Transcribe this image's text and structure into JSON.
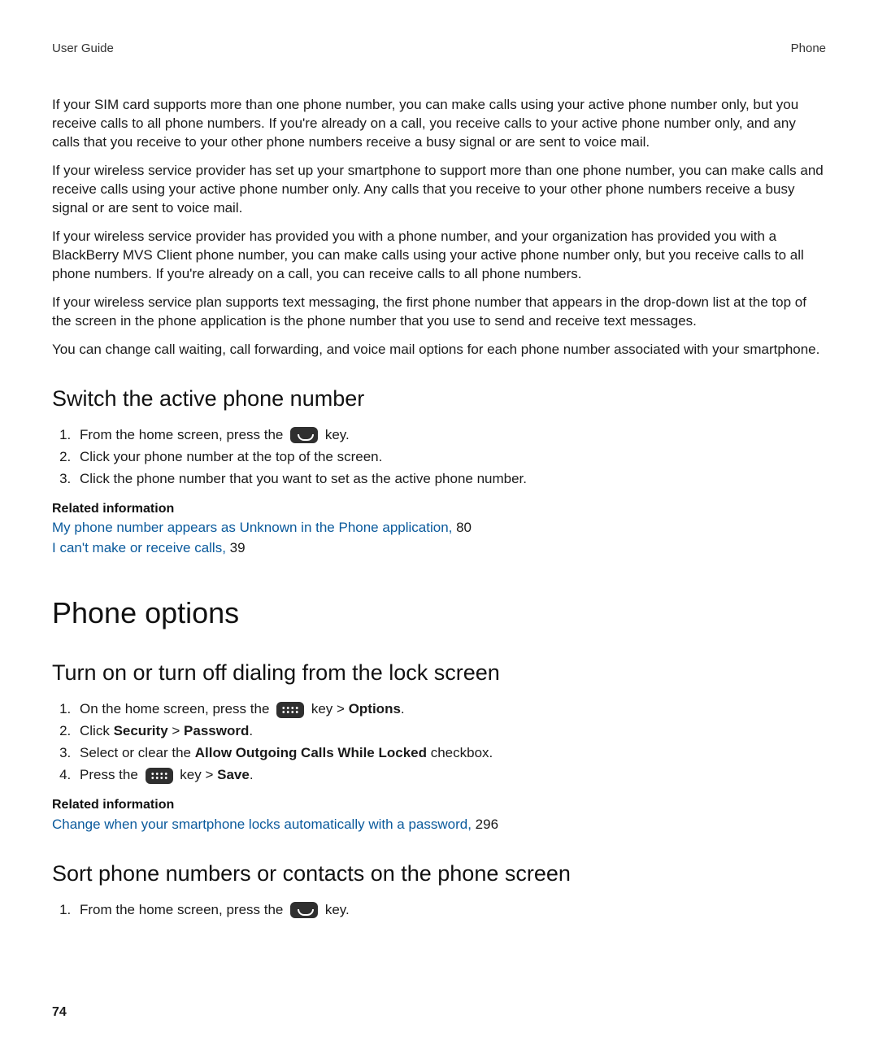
{
  "header": {
    "left": "User Guide",
    "right": "Phone"
  },
  "intro": {
    "p1": "If your SIM card supports more than one phone number, you can make calls using your active phone number only, but you receive calls to all phone numbers. If you're already on a call, you receive calls to your active phone number only, and any calls that you receive to your other phone numbers receive a busy signal or are sent to voice mail.",
    "p2": "If your wireless service provider has set up your smartphone to support more than one phone number, you can make calls and receive calls using your active phone number only. Any calls that you receive to your other phone numbers receive a busy signal or are sent to voice mail.",
    "p3": "If your wireless service provider has provided you with a phone number, and your organization has provided you with a BlackBerry MVS Client phone number, you can make calls using your active phone number only, but you receive calls to all phone numbers. If you're already on a call, you can receive calls to all phone numbers.",
    "p4": "If your wireless service plan supports text messaging, the first phone number that appears in the drop-down list at the top of the screen in the phone application is the phone number that you use to send and receive text messages.",
    "p5": "You can change call waiting, call forwarding, and voice mail options for each phone number associated with your smartphone."
  },
  "switch": {
    "heading": "Switch the active phone number",
    "step1_before": "From the home screen, press the ",
    "step1_after": " key.",
    "step2": "Click your phone number at the top of the screen.",
    "step3": "Click the phone number that you want to set as the active phone number.",
    "related_hd": "Related information",
    "rel1_link": "My phone number appears as Unknown in the Phone application, ",
    "rel1_page": "80",
    "rel2_link": "I can't make or receive calls, ",
    "rel2_page": "39"
  },
  "options": {
    "chapter": "Phone options",
    "heading": "Turn on or turn off dialing from the lock screen",
    "step1_before": "On the home screen, press the ",
    "step1_mid": " key > ",
    "step1_bold": "Options",
    "step1_end": ".",
    "step2_before": "Click ",
    "step2_b1": "Security",
    "step2_gt": " > ",
    "step2_b2": "Password",
    "step2_end": ".",
    "step3_before": "Select or clear the ",
    "step3_bold": "Allow Outgoing Calls While Locked",
    "step3_after": " checkbox.",
    "step4_before": "Press the ",
    "step4_mid": " key > ",
    "step4_bold": "Save",
    "step4_end": ".",
    "related_hd": "Related information",
    "rel1_link": "Change when your smartphone locks automatically with a password, ",
    "rel1_page": "296"
  },
  "sort": {
    "heading": "Sort phone numbers or contacts on the phone screen",
    "step1_before": "From the home screen, press the ",
    "step1_after": " key."
  },
  "page_number": "74"
}
